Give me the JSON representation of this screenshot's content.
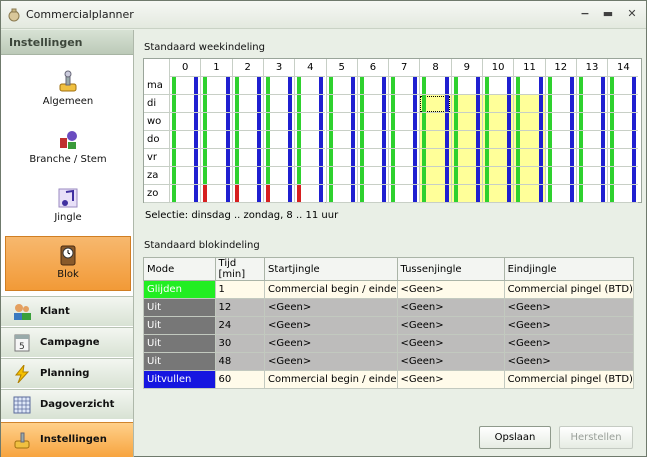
{
  "window": {
    "title": "Commercialplanner",
    "minimize": "−",
    "maximize": "▬",
    "close": "✕"
  },
  "sidebar": {
    "header": "Instellingen",
    "items": [
      {
        "label": "Algemeen",
        "icon": "settings-joystick-icon",
        "active": false
      },
      {
        "label": "Branche / Stem",
        "icon": "branche-icon",
        "active": false
      },
      {
        "label": "Jingle",
        "icon": "music-note-icon",
        "active": false
      },
      {
        "label": "Blok",
        "icon": "clock-icon",
        "active": true
      }
    ],
    "nav": [
      {
        "label": "Klant",
        "icon": "people-icon",
        "active": false
      },
      {
        "label": "Campagne",
        "icon": "calendar-icon",
        "active": false
      },
      {
        "label": "Planning",
        "icon": "lightning-icon",
        "active": false
      },
      {
        "label": "Dagoverzicht",
        "icon": "grid-icon",
        "active": false
      },
      {
        "label": "Instellingen",
        "icon": "tools-icon",
        "active": true
      }
    ]
  },
  "week": {
    "label": "Standaard weekindeling",
    "days": [
      "ma",
      "di",
      "wo",
      "do",
      "vr",
      "za",
      "zo"
    ],
    "hours": [
      "0",
      "1",
      "2",
      "3",
      "4",
      "5",
      "6",
      "7",
      "8",
      "9",
      "10",
      "11",
      "12",
      "13",
      "14"
    ],
    "selected_days": [
      "di",
      "wo",
      "do",
      "vr",
      "za",
      "zo"
    ],
    "selected_hours": [
      "8",
      "9",
      "10",
      "11"
    ],
    "colors": {
      "blue": "#1f1fd0",
      "green": "#2ed12e",
      "red": "#d61f1f",
      "yellow": "#ffff99",
      "gray": "#c8cfc6"
    }
  },
  "selection_text": "Selectie: dinsdag .. zondag, 8 .. 11 uur",
  "blok": {
    "label": "Standaard blokindeling",
    "columns": [
      "Mode",
      "Tijd [min]",
      "Startjingle",
      "Tussenjingle",
      "Eindjingle"
    ],
    "rows": [
      {
        "mode": "Glijden",
        "mode_color": "#22ee22",
        "tijd": "1",
        "start": "Commercial begin / einde",
        "tussen": "<Geen>",
        "eind": "Commercial pingel (BTD)",
        "style": "light"
      },
      {
        "mode": "Uit",
        "mode_color": "#777777",
        "tijd": "12",
        "start": "<Geen>",
        "tussen": "<Geen>",
        "eind": "<Geen>",
        "style": "gray"
      },
      {
        "mode": "Uit",
        "mode_color": "#777777",
        "tijd": "24",
        "start": "<Geen>",
        "tussen": "<Geen>",
        "eind": "<Geen>",
        "style": "gray"
      },
      {
        "mode": "Uit",
        "mode_color": "#777777",
        "tijd": "30",
        "start": "<Geen>",
        "tussen": "<Geen>",
        "eind": "<Geen>",
        "style": "gray"
      },
      {
        "mode": "Uit",
        "mode_color": "#777777",
        "tijd": "48",
        "start": "<Geen>",
        "tussen": "<Geen>",
        "eind": "<Geen>",
        "style": "gray"
      },
      {
        "mode": "Uitvullen",
        "mode_color": "#1616e0",
        "tijd": "60",
        "start": "Commercial begin / einde",
        "tussen": "<Geen>",
        "eind": "Commercial pingel (BTD)",
        "style": "light"
      }
    ]
  },
  "buttons": {
    "save": "Opslaan",
    "restore": "Herstellen"
  }
}
